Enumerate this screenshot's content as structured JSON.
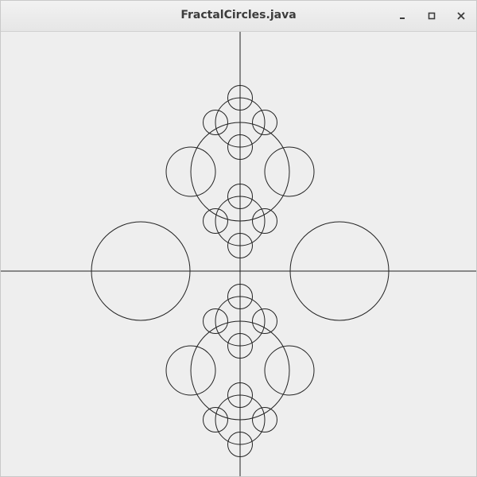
{
  "window": {
    "title": "FractalCircles.java",
    "controls": {
      "minimize_icon": "minimize-icon",
      "maximize_icon": "maximize-icon",
      "close_icon": "close-icon"
    }
  },
  "canvas": {
    "background": "#eeeeee",
    "stroke_color": "#222222"
  }
}
